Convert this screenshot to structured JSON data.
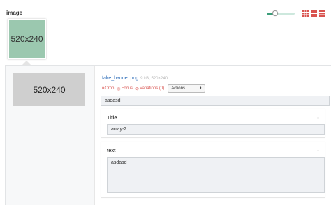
{
  "field": {
    "label": "image"
  },
  "toolbar": {
    "zoom_level": 0.3,
    "accent_color": "#3c9e7a",
    "view_icons": [
      "grid-large-icon",
      "grid-small-icon",
      "list-icon"
    ]
  },
  "thumbnail": {
    "text": "520x240"
  },
  "item": {
    "preview_text": "520x240",
    "filename": "fake_banner.png",
    "fileinfo": "9 kB, 520×240",
    "crop_label": "Crop",
    "focus_label": "Focus",
    "variations_label": "Variations (0)",
    "actions_label": "Actions",
    "description_value": "asdasd"
  },
  "title_field": {
    "label": "Title",
    "value": "array-2"
  },
  "text_field": {
    "label": "text",
    "value": "asdasd"
  }
}
